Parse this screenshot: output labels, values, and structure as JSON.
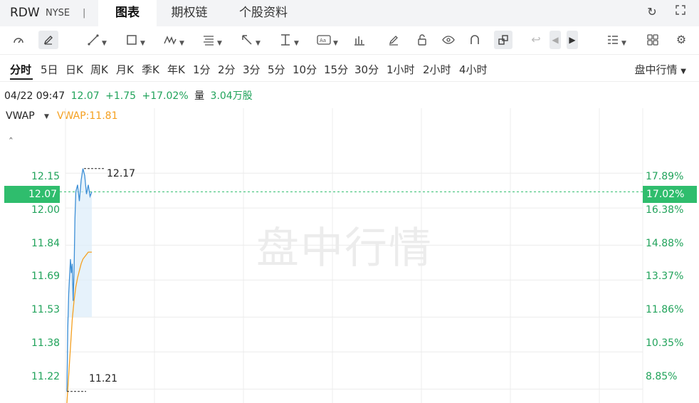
{
  "header": {
    "symbol": "RDW",
    "exchange": "NYSE",
    "separator": "|",
    "tabs": [
      {
        "label": "图表",
        "active": true
      },
      {
        "label": "期权链",
        "active": false
      },
      {
        "label": "个股资料",
        "active": false
      }
    ],
    "icons": [
      "refresh-icon",
      "fullscreen-icon"
    ]
  },
  "toolbar": {
    "icons": [
      "gauge-icon",
      "pen-icon",
      "trend-line-icon",
      "rectangle-icon",
      "pattern-icon",
      "fibonacci-icon",
      "arrow-icon",
      "measure-icon",
      "text-icon",
      "volume-bars-icon",
      "eraser-icon",
      "lock-icon",
      "eye-icon",
      "magnet-icon",
      "link-icon",
      "undo-icon",
      "left-arrow-icon",
      "right-arrow-icon",
      "layout-icon",
      "grid-icon",
      "settings-icon"
    ]
  },
  "periods": {
    "items": [
      "分时",
      "5日",
      "日K",
      "周K",
      "月K",
      "季K",
      "年K",
      "1分",
      "2分",
      "3分",
      "5分",
      "10分",
      "15分",
      "30分",
      "1小时",
      "2小时",
      "4小时"
    ],
    "active": "分时",
    "session": "盘中行情"
  },
  "info": {
    "datetime": "04/22 09:47",
    "price": "12.07",
    "change": "+1.75",
    "change_pct": "+17.02%",
    "volume_label": "量",
    "volume": "3.04万股"
  },
  "indicator": {
    "name": "VWAP",
    "value_label": "VWAP:11.81"
  },
  "colors": {
    "up": "#21a35b",
    "price_line": "#3d8fd6",
    "vwap_line": "#f5a020",
    "current_box": "#2fbd6d"
  },
  "chart_data": {
    "type": "line",
    "y_left_ticks": [
      "12.15",
      "12.00",
      "11.84",
      "11.69",
      "11.53",
      "11.38",
      "11.22"
    ],
    "y_right_ticks": [
      "17.89%",
      "16.38%",
      "14.88%",
      "13.37%",
      "11.86%",
      "10.35%",
      "8.85%"
    ],
    "current_price": "12.07",
    "current_pct": "17.02%",
    "high_label": "12.17",
    "low_label": "11.21",
    "watermark": "盘中行情",
    "ylim": [
      11.16,
      12.43
    ],
    "series": [
      {
        "name": "price",
        "points": [
          [
            0,
            11.21
          ],
          [
            0.5,
            11.48
          ],
          [
            1,
            11.63
          ],
          [
            2,
            11.78
          ],
          [
            2.5,
            11.72
          ],
          [
            3,
            11.76
          ],
          [
            3.5,
            11.6
          ],
          [
            4,
            11.72
          ],
          [
            4.5,
            11.95
          ],
          [
            5,
            12.07
          ],
          [
            6,
            12.1
          ],
          [
            7,
            12.03
          ],
          [
            8,
            12.12
          ],
          [
            9,
            12.17
          ],
          [
            10,
            12.14
          ],
          [
            11,
            12.06
          ],
          [
            12,
            12.1
          ],
          [
            13,
            12.05
          ],
          [
            14,
            12.07
          ]
        ]
      },
      {
        "name": "VWAP",
        "points": [
          [
            0,
            11.16
          ],
          [
            1,
            11.28
          ],
          [
            2,
            11.4
          ],
          [
            3,
            11.52
          ],
          [
            4,
            11.6
          ],
          [
            5,
            11.66
          ],
          [
            6,
            11.7
          ],
          [
            7,
            11.73
          ],
          [
            8,
            11.76
          ],
          [
            9,
            11.78
          ],
          [
            10,
            11.79
          ],
          [
            11,
            11.8
          ],
          [
            12,
            11.81
          ],
          [
            14,
            11.81
          ]
        ]
      }
    ]
  }
}
